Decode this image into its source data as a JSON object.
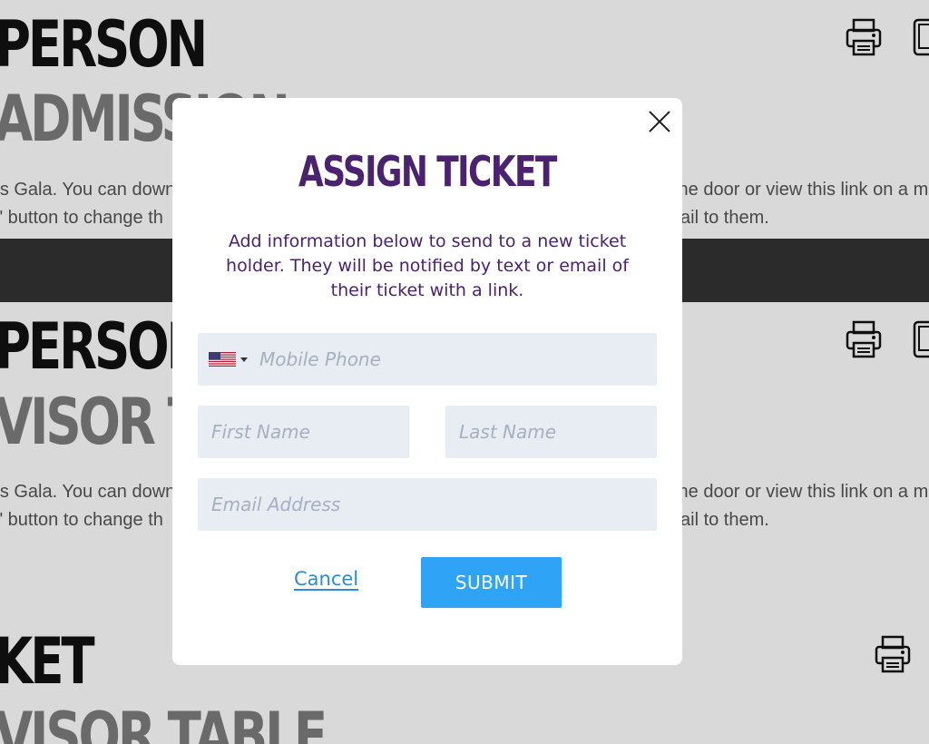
{
  "background": {
    "tickets": [
      {
        "heading_top": "PERSON",
        "heading_sub": "ADMISSION",
        "desc_line1": "'s Gala. You can down",
        "desc_line1_right": "the door or view this link on a m",
        "desc_line2": "\" button to change th",
        "desc_line2_right": "ail to them."
      },
      {
        "heading_top": "PERSON",
        "heading_sub": "VISOR TAB",
        "desc_line1": "'s Gala. You can down",
        "desc_line1_right": "the door or view this link on a m",
        "desc_line2": "\" button to change th",
        "desc_line2_right": "ail to them."
      },
      {
        "heading_top": "KET",
        "heading_sub": "VISOR TABLE"
      }
    ]
  },
  "modal": {
    "title": "ASSIGN TICKET",
    "description": "Add information below to send to a new ticket holder. They will be notified by text or email of their ticket with a link.",
    "phone": {
      "placeholder": "Mobile Phone",
      "country": "US",
      "value": ""
    },
    "first_name": {
      "placeholder": "First Name",
      "value": ""
    },
    "last_name": {
      "placeholder": "Last Name",
      "value": ""
    },
    "email": {
      "placeholder": "Email Address",
      "value": ""
    },
    "cancel_label": "Cancel",
    "submit_label": "SUBMIT"
  },
  "colors": {
    "title": "#4a2270",
    "submit_bg": "#2fa4f6",
    "cancel_link": "#2b8dd8",
    "field_bg": "#e8ecf3"
  },
  "icons": [
    "close-icon",
    "printer-icon",
    "tablet-icon",
    "us-flag-icon",
    "caret-down-icon"
  ]
}
